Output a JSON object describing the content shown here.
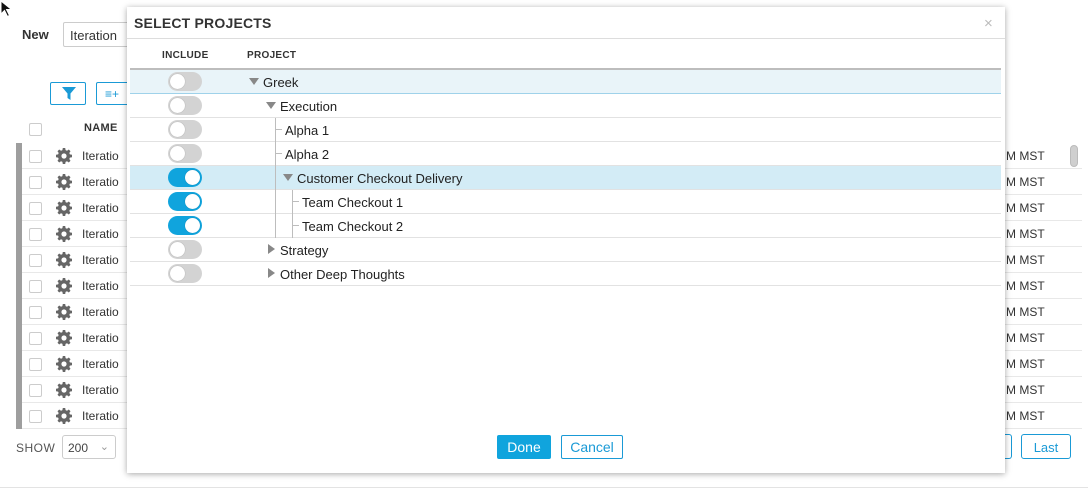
{
  "background": {
    "new_label": "New",
    "new_input_value": "Iteration",
    "add_button_label": "≡+",
    "name_header": "NAME",
    "rows": [
      {
        "name": "Iteratio",
        "date_suffix": "M MST"
      },
      {
        "name": "Iteratio",
        "date_suffix": "M MST"
      },
      {
        "name": "Iteratio",
        "date_suffix": "M MST"
      },
      {
        "name": "Iteratio",
        "date_suffix": "M MST"
      },
      {
        "name": "Iteratio",
        "date_suffix": "M MST"
      },
      {
        "name": "Iteratio",
        "date_suffix": "M MST"
      },
      {
        "name": "Iteratio",
        "date_suffix": "M MST"
      },
      {
        "name": "Iteratio",
        "date_suffix": "M MST"
      },
      {
        "name": "Iteratio",
        "date_suffix": "M MST"
      },
      {
        "name": "Iteratio",
        "date_suffix": "M MST"
      },
      {
        "name": "Iteratio",
        "date_suffix": "M MST"
      }
    ],
    "show_label": "SHOW",
    "show_value": "200",
    "last_button_label": "Last"
  },
  "modal": {
    "title": "SELECT PROJECTS",
    "close_glyph": "×",
    "columns": {
      "include": "INCLUDE",
      "project": "PROJECT"
    },
    "projects": [
      {
        "label": "Greek",
        "included": false,
        "level": 0,
        "expander": "expanded"
      },
      {
        "label": "Execution",
        "included": false,
        "level": 1,
        "expander": "expanded"
      },
      {
        "label": "Alpha 1",
        "included": false,
        "level": 2,
        "expander": "none"
      },
      {
        "label": "Alpha 2",
        "included": false,
        "level": 2,
        "expander": "none"
      },
      {
        "label": "Customer Checkout Delivery",
        "included": true,
        "level": 2,
        "expander": "expanded"
      },
      {
        "label": "Team Checkout 1",
        "included": true,
        "level": 3,
        "expander": "none"
      },
      {
        "label": "Team Checkout 2",
        "included": true,
        "level": 3,
        "expander": "none"
      },
      {
        "label": "Strategy",
        "included": false,
        "level": 1,
        "expander": "collapsed"
      },
      {
        "label": "Other Deep Thoughts",
        "included": false,
        "level": 1,
        "expander": "collapsed"
      }
    ],
    "done_label": "Done",
    "cancel_label": "Cancel"
  },
  "colors": {
    "accent": "#10a4dd",
    "toggle_off": "#d3d3d3",
    "selected_row": "#d3ecf6"
  }
}
